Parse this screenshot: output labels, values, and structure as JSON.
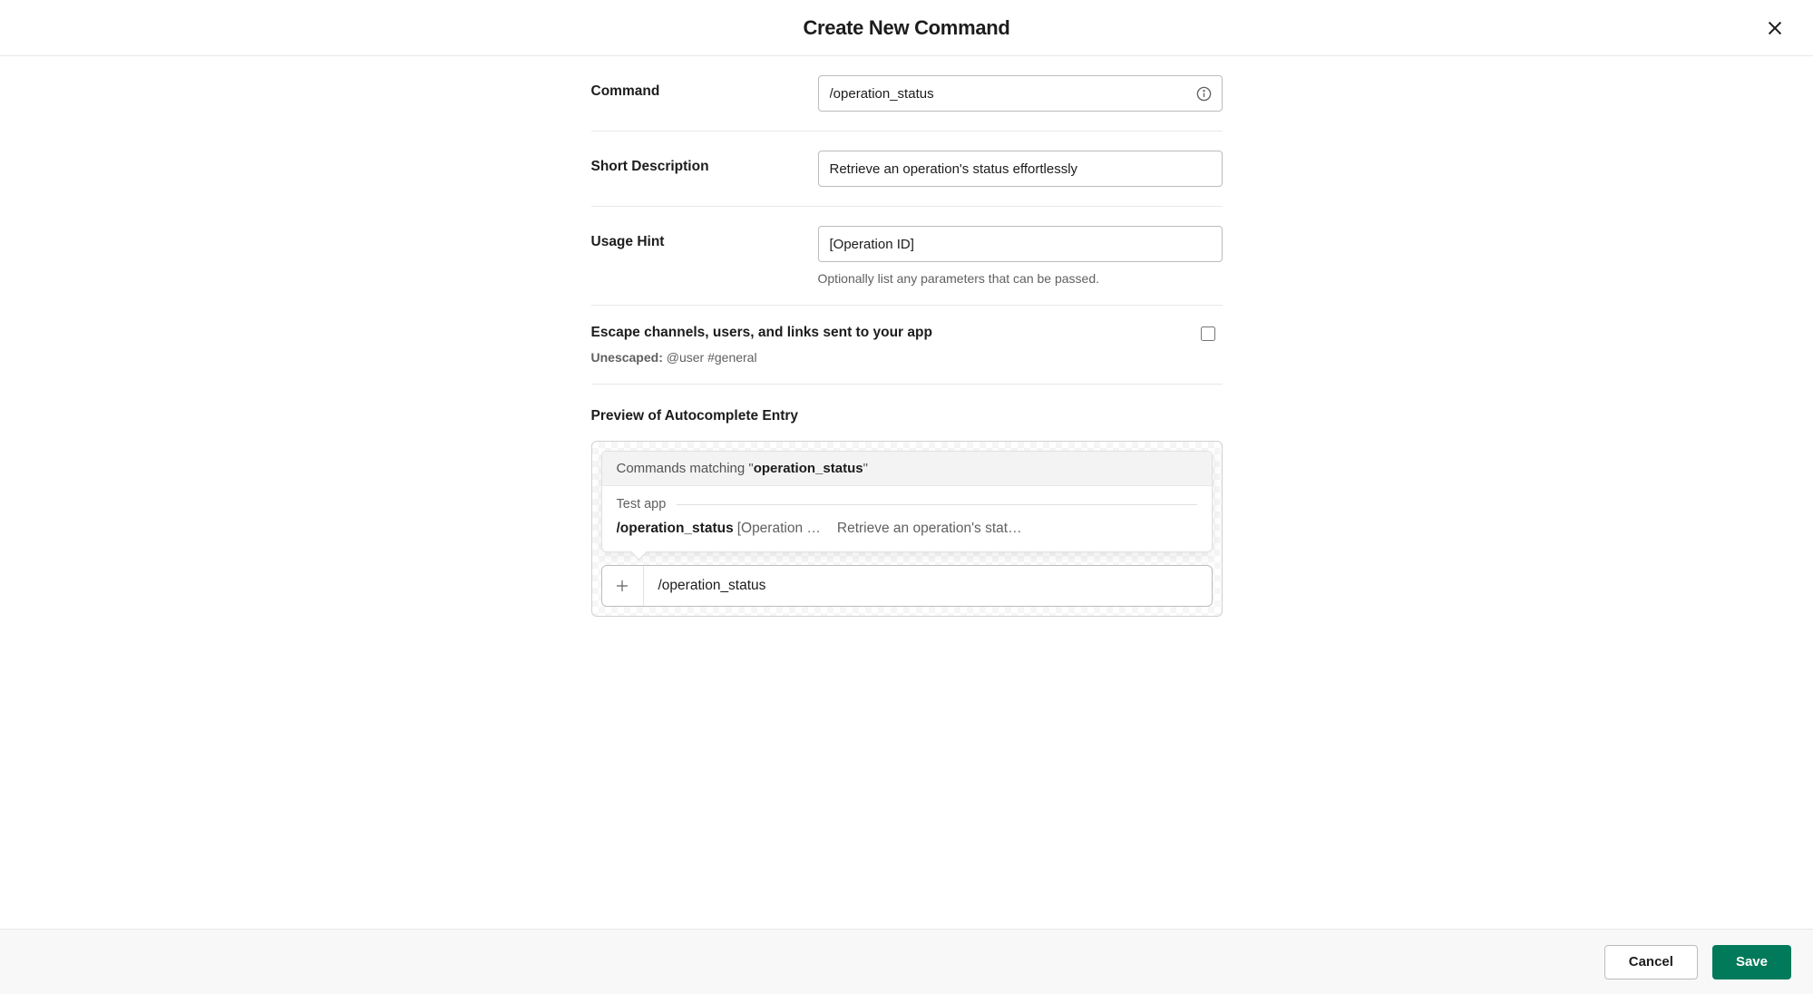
{
  "header": {
    "title": "Create New Command"
  },
  "fields": {
    "command": {
      "label": "Command",
      "value": "/operation_status"
    },
    "short_description": {
      "label": "Short Description",
      "value": "Retrieve an operation's status effortlessly"
    },
    "usage_hint": {
      "label": "Usage Hint",
      "value": "[Operation ID]",
      "helper": "Optionally list any parameters that can be passed."
    },
    "escape": {
      "label": "Escape channels, users, and links sent to your app",
      "sub_prefix": "Unescaped:",
      "sub_example": " @user #general",
      "checked": false
    }
  },
  "preview": {
    "title": "Preview of Autocomplete Entry",
    "matching_prefix": "Commands matching \"",
    "matching_term": "operation_status",
    "matching_suffix": "\"",
    "app_name": "Test app",
    "cmd_name": "/operation_status",
    "cmd_hint": "[Operation …",
    "cmd_desc": "Retrieve an operation's stat…",
    "input_value": "/operation_status"
  },
  "footer": {
    "cancel": "Cancel",
    "save": "Save"
  }
}
